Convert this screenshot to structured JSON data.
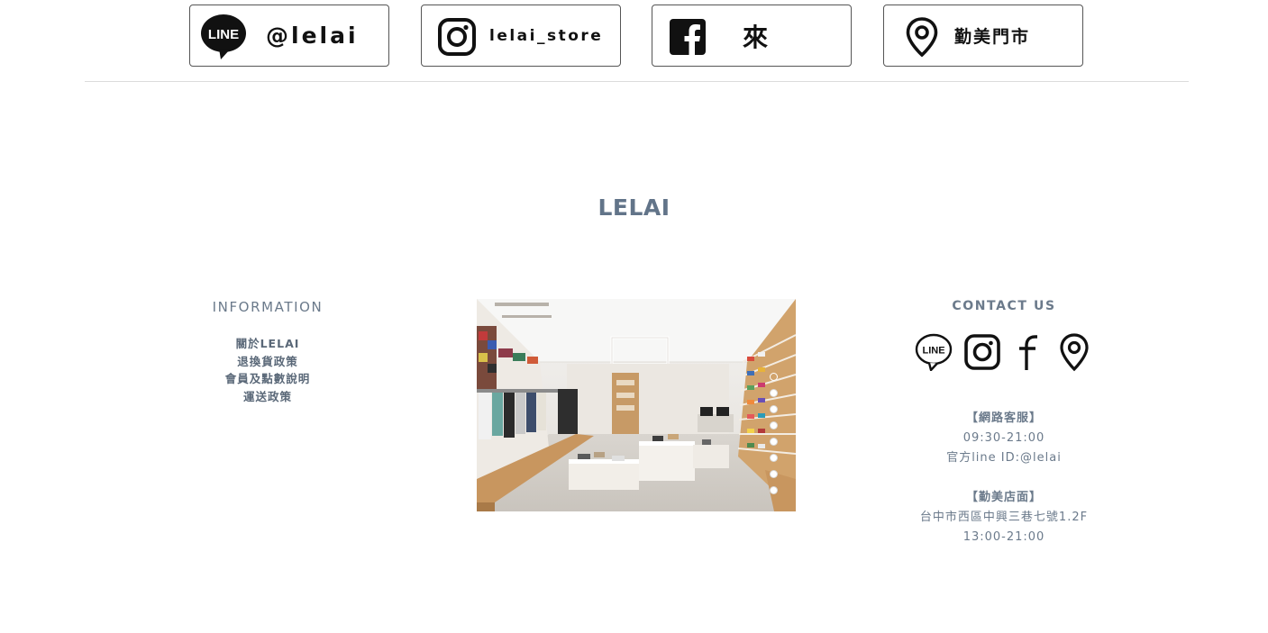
{
  "social_buttons": {
    "line_label": "@lelai",
    "instagram_label": "lelai_store",
    "facebook_label": "來",
    "store_label": "勤美門市"
  },
  "line_icon_text": "LINE",
  "brand": "LELAI",
  "information": {
    "title": "INFORMATION",
    "links": [
      "關於LELAI",
      "退換貨政策",
      "會員及點數說明",
      "運送政策"
    ]
  },
  "slideshow": {
    "slide_count": 8,
    "active_index": 0
  },
  "contact": {
    "title": "CONTACT US",
    "icons": [
      "line-icon",
      "instagram-icon",
      "facebook-icon",
      "map-pin-icon"
    ],
    "line_icon_text": "LINE",
    "online_heading": "【網路客服】",
    "online_hours": "09:30-21:00",
    "line_id": "官方line ID:@lelai",
    "store_heading": "【勤美店面】",
    "store_address": "台中市西區中興三巷七號1.2F",
    "store_hours": "13:00-21:00"
  },
  "colors": {
    "text": "#5f6e7f",
    "brand": "#627489",
    "divider": "#dcdcdc",
    "border": "#555555"
  }
}
